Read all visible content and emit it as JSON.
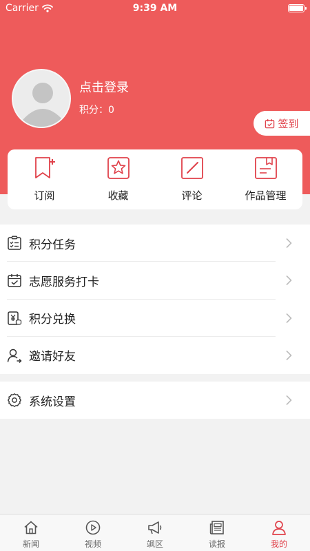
{
  "status_bar": {
    "carrier": "Carrier",
    "time": "9:39 AM"
  },
  "profile": {
    "login_prompt": "点击登录",
    "points": "积分：0"
  },
  "checkin": {
    "label": "签到"
  },
  "quick_actions": [
    {
      "label": "订阅",
      "icon": "bookmark-plus-icon"
    },
    {
      "label": "收藏",
      "icon": "star-icon"
    },
    {
      "label": "评论",
      "icon": "edit-icon"
    },
    {
      "label": "作品管理",
      "icon": "document-icon"
    }
  ],
  "menu": [
    {
      "label": "积分任务",
      "icon": "clipboard-check-icon"
    },
    {
      "label": "志愿服务打卡",
      "icon": "calendar-check-icon"
    },
    {
      "label": "积分兑换",
      "icon": "yuan-exchange-icon"
    },
    {
      "label": "邀请好友",
      "icon": "user-invite-icon"
    }
  ],
  "settings": {
    "label": "系统设置",
    "icon": "gear-icon"
  },
  "tabbar": {
    "items": [
      {
        "label": "新闻",
        "icon": "home-icon"
      },
      {
        "label": "视频",
        "icon": "play-icon"
      },
      {
        "label": "飒区",
        "icon": "megaphone-icon"
      },
      {
        "label": "读报",
        "icon": "newspaper-icon"
      },
      {
        "label": "我的",
        "icon": "person-icon"
      }
    ],
    "active_index": 4
  },
  "colors": {
    "brand": "#ee5b5b",
    "accent": "#e0414a",
    "background": "#f2f2f2"
  }
}
